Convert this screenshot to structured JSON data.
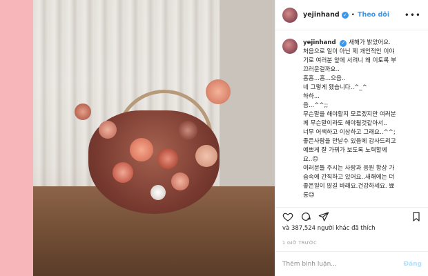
{
  "post": {
    "username": "yejinhand",
    "follow_label": "Theo dõi",
    "separator": "•",
    "more": "•••",
    "caption_lines": [
      "새해가 밝았어요.",
      "처음으로 일이 아닌 제 개인적인 이야",
      "기로 여러분 앞에 서려니 왜 이토록 부",
      "끄러운걸까요..",
      "흠흠...흠...으음..",
      "네 그렇게 됐습니다..^_^",
      "하하...",
      "음...^^;;",
      "무슨말을 해야할지 모르겠지만 여러분",
      "께 무슨말이라도 해야될것같아서..",
      "너무 어색하고 이상하고 그래요..^^;",
      "좋은사람을 만날수 있음에 감사드리고",
      "예쁘게 잘 가꿔가 보도록 노력할께",
      "요..☺",
      "여러분들 주시는 사랑과 응원 항상 가",
      "슴속에 간직하고 있어요..새해에는 더",
      "좋은일이 많길 바래요.건강하세요. 뾰",
      "롱☺"
    ],
    "likes_text": "và 387,524 người khác đã thích",
    "timestamp": "1 GIỜ TRƯỚC",
    "comment_placeholder": "Thêm bình luận...",
    "post_button": "Đăng"
  },
  "icons": [
    "heart-icon",
    "comment-icon",
    "share-icon",
    "bookmark-icon",
    "verified-icon"
  ],
  "colors": {
    "background": "#f7b6b9",
    "link_blue": "#3897f0",
    "post_disabled": "#b2dffc"
  }
}
